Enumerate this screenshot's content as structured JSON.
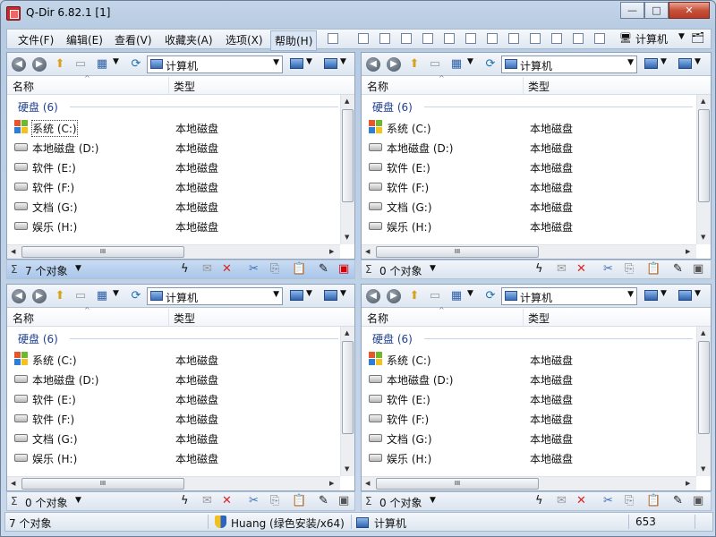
{
  "window": {
    "title": "Q-Dir 6.82.1 [1]",
    "min": "—",
    "max": "□",
    "close": "✕"
  },
  "menu": [
    "文件(F)",
    "编辑(E)",
    "查看(V)",
    "收藏夹(A)",
    "选项(X)",
    "帮助(H)"
  ],
  "menu_address": "计算机",
  "pane": {
    "address": "计算机",
    "col_name": "名称",
    "col_type": "类型",
    "group": "硬盘 (6)",
    "rows": [
      {
        "name": "系统 (C:)",
        "type": "本地磁盘"
      },
      {
        "name": "本地磁盘 (D:)",
        "type": "本地磁盘"
      },
      {
        "name": "软件 (E:)",
        "type": "本地磁盘"
      },
      {
        "name": "软件 (F:)",
        "type": "本地磁盘"
      },
      {
        "name": "文档 (G:)",
        "type": "本地磁盘"
      },
      {
        "name": "娱乐 (H:)",
        "type": "本地磁盘"
      }
    ],
    "hthumb": "III"
  },
  "panes_status": [
    "7 个对象",
    "0 个对象",
    "0 个对象",
    "0 个对象"
  ],
  "status": {
    "sigma": "Σ",
    "left": "7 个对象",
    "user": "Huang (绿色安装/x64)",
    "location": "计算机",
    "number": "653"
  }
}
